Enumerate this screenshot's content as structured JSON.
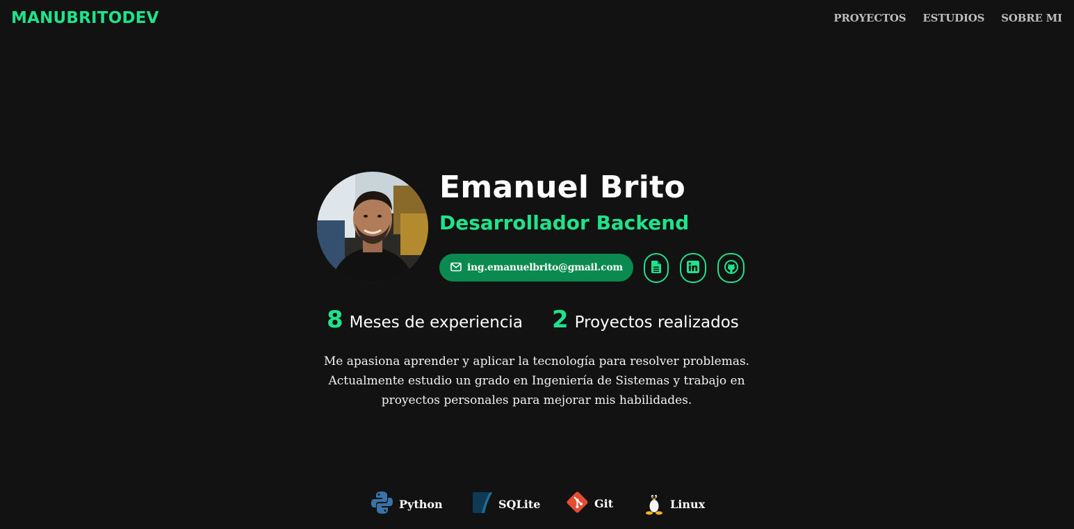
{
  "header": {
    "logo": "MANUBRITODEV",
    "nav": [
      {
        "label": "PROYECTOS"
      },
      {
        "label": "ESTUDIOS"
      },
      {
        "label": "SOBRE MI"
      }
    ]
  },
  "hero": {
    "name": "Emanuel Brito",
    "role": "Desarrollador Backend",
    "email": "ing.emanuelbrito@gmail.com",
    "icons": {
      "email": "envelope-icon",
      "cv": "document-icon",
      "linkedin": "linkedin-icon",
      "github": "github-icon"
    }
  },
  "stats": [
    {
      "number": "8",
      "label": "Meses de experiencia"
    },
    {
      "number": "2",
      "label": "Proyectos realizados"
    }
  ],
  "description": "Me apasiona aprender y aplicar la tecnología para resolver problemas. Actualmente estudio un grado en Ingeniería de Sistemas y trabajo en proyectos personales para mejorar mis habilidades.",
  "tech": [
    {
      "name": "Python",
      "icon": "python-icon"
    },
    {
      "name": "SQLite",
      "icon": "sqlite-icon"
    },
    {
      "name": "Git",
      "icon": "git-icon"
    },
    {
      "name": "Linux",
      "icon": "linux-tux-icon"
    }
  ],
  "colors": {
    "background": "#121212",
    "accent": "#1ee38a",
    "email_button": "#0a8a4f",
    "nav_text": "#bdbdbd"
  }
}
